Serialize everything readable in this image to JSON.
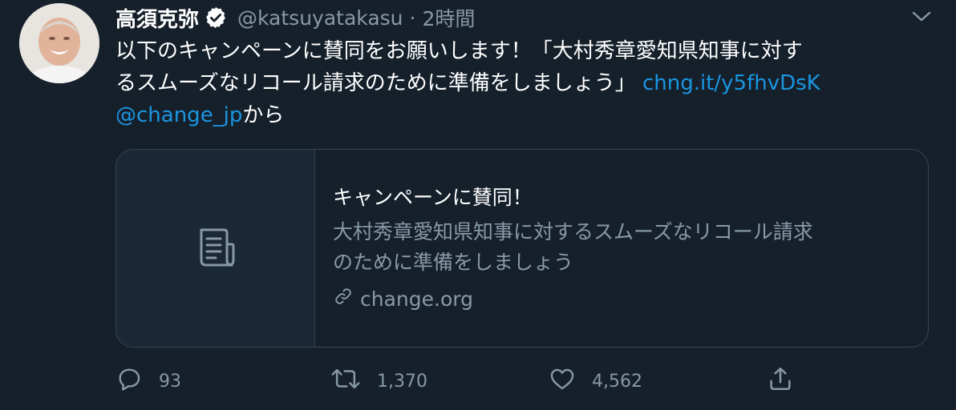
{
  "tweet": {
    "author": {
      "name": "高須克弥",
      "handle": "@katsuyatakasu",
      "separator": "·",
      "time": "2時間",
      "verified": true
    },
    "text": {
      "line1": "以下のキャンペーンに賛同をお願いします！「大村秀章愛知県知事に対す",
      "line2_text": "るスムーズなリコール請求のために準備をしましょう」 ",
      "line2_link": "chng.it/y5fhvDsK",
      "line3_mention": "@change_jp",
      "line3_suffix": "から"
    },
    "card": {
      "title": "キャンペーンに賛同！",
      "description_line1": "大村秀章愛知県知事に対するスムーズなリコール請求",
      "description_line2": "のために準備をしましょう",
      "domain": "change.org",
      "thumb_icon": "document-icon"
    },
    "actions": {
      "replies": "93",
      "retweets": "1,370",
      "likes": "4,562"
    }
  },
  "colors": {
    "background": "#15202b",
    "link": "#1b95e0",
    "secondary_text": "#8899a6",
    "border": "#38444d",
    "card_thumb_bg": "#1b2836"
  }
}
